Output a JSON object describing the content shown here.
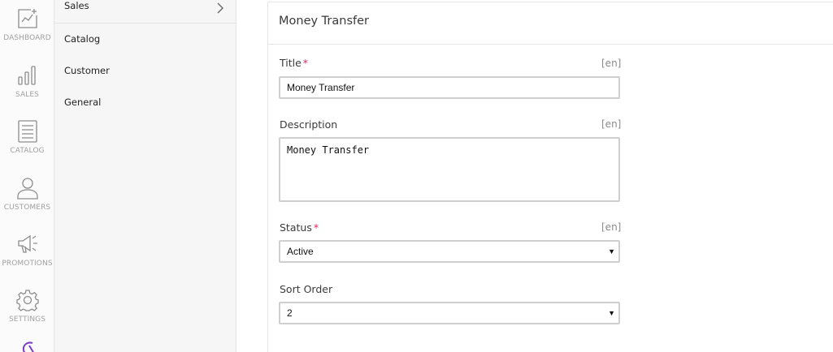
{
  "rail": {
    "items": [
      {
        "label": "DASHBOARD",
        "icon": "dashboard-icon"
      },
      {
        "label": "SALES",
        "icon": "sales-icon"
      },
      {
        "label": "CATALOG",
        "icon": "catalog-icon"
      },
      {
        "label": "CUSTOMERS",
        "icon": "customers-icon"
      },
      {
        "label": "PROMOTIONS",
        "icon": "promotions-icon"
      },
      {
        "label": "SETTINGS",
        "icon": "settings-icon"
      }
    ],
    "accent": "#7e3fc6"
  },
  "submenu": {
    "items": [
      {
        "label": "Sales"
      },
      {
        "label": "Catalog"
      },
      {
        "label": "Customer"
      },
      {
        "label": "General"
      }
    ]
  },
  "form": {
    "title": "Money Transfer",
    "required_mark": "*",
    "title_field": {
      "label": "Title",
      "lang": "[en]",
      "value": "Money Transfer"
    },
    "description_field": {
      "label": "Description",
      "lang": "[en]",
      "value": "Money Transfer"
    },
    "status_field": {
      "label": "Status",
      "lang": "[en]",
      "value": "Active"
    },
    "sort_order_field": {
      "label": "Sort Order",
      "value": "2"
    }
  }
}
